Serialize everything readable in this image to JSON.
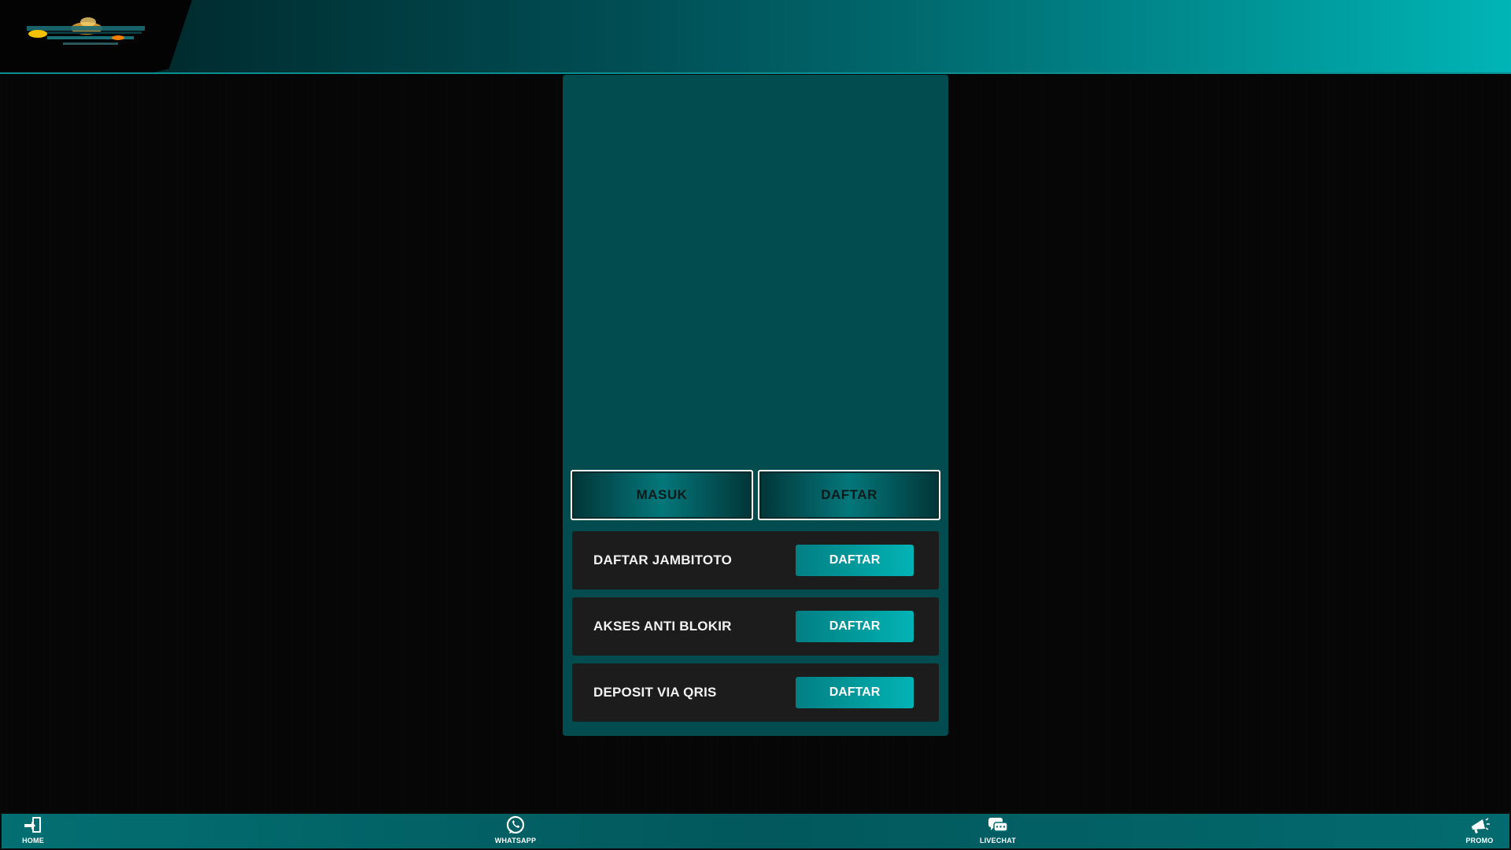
{
  "header": {
    "logo_icon": "site-logo"
  },
  "auth": {
    "login_label": "MASUK",
    "register_label": "DAFTAR"
  },
  "promo_cards": [
    {
      "label": "DAFTAR JAMBITOTO",
      "button_label": "DAFTAR"
    },
    {
      "label": "AKSES ANTI BLOKIR",
      "button_label": "DAFTAR"
    },
    {
      "label": "DEPOSIT VIA QRIS",
      "button_label": "DAFTAR"
    }
  ],
  "bottom_nav": [
    {
      "label": "HOME",
      "icon": "login-door-icon"
    },
    {
      "label": "WHATSAPP",
      "icon": "whatsapp-icon"
    },
    {
      "label": "LIVECHAT",
      "icon": "chat-bubbles-icon"
    },
    {
      "label": "PROMO",
      "icon": "megaphone-icon"
    }
  ],
  "colors": {
    "accent": "#03b3b5",
    "panel": "#024b4e",
    "card": "#1c1c1c",
    "background": "#060606"
  }
}
